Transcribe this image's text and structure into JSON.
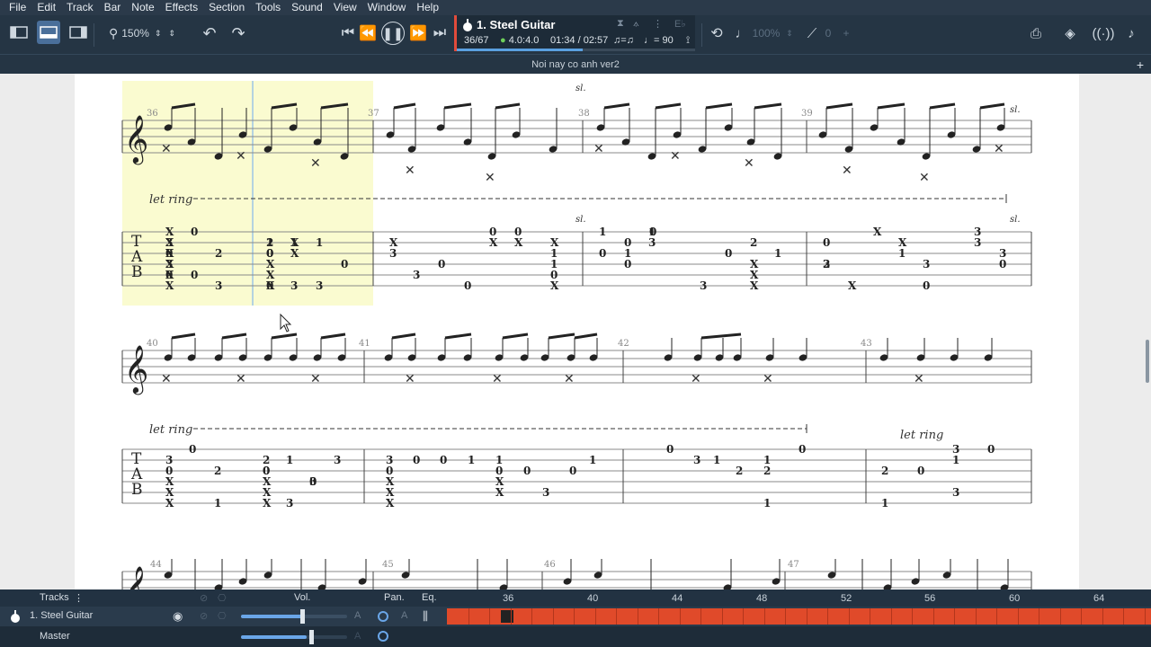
{
  "menu": [
    "File",
    "Edit",
    "Track",
    "Bar",
    "Note",
    "Effects",
    "Section",
    "Tools",
    "Sound",
    "View",
    "Window",
    "Help"
  ],
  "toolbar": {
    "zoom": "150%",
    "track_name": "1. Steel Guitar",
    "bar_position": "36/67",
    "time_signature": "4.0:4.0",
    "time": "01:34 / 02:57",
    "tempo": "= 90",
    "volume_pct": "100%",
    "capo": "0",
    "playback_progress": 0.53
  },
  "document": {
    "title": "Noi nay co anh ver2"
  },
  "score": {
    "bar_numbers": [
      "36",
      "37",
      "38",
      "39",
      "40",
      "41",
      "42",
      "43",
      "44",
      "45",
      "46",
      "47"
    ],
    "let_ring": "let ring",
    "slide": "sl.",
    "tab_letters": [
      "T",
      "A",
      "B"
    ],
    "system1_tab": [
      {
        "t": "0"
      },
      {
        "t": "3"
      },
      {
        "t": "0"
      },
      {
        "t": "X"
      },
      {
        "t": "X"
      },
      {
        "t": "X"
      },
      {
        "t": "2"
      },
      {
        "t": "1"
      },
      {
        "t": "3"
      },
      {
        "t": "2"
      },
      {
        "t": "0"
      },
      {
        "t": "X"
      },
      {
        "t": "X"
      },
      {
        "t": "X"
      },
      {
        "t": "1"
      },
      {
        "t": "3"
      },
      {
        "t": "0"
      },
      {
        "t": "X"
      },
      {
        "t": "3"
      },
      {
        "t": "3"
      },
      {
        "t": "0"
      },
      {
        "t": "0"
      },
      {
        "t": "0"
      },
      {
        "t": "0"
      },
      {
        "t": "X"
      },
      {
        "t": "X"
      },
      {
        "t": "1"
      },
      {
        "t": "1"
      },
      {
        "t": "0"
      },
      {
        "t": "X"
      },
      {
        "t": "X"
      },
      {
        "t": "1"
      },
      {
        "t": "0"
      },
      {
        "t": "3"
      },
      {
        "t": "1"
      },
      {
        "t": "0"
      },
      {
        "t": "1"
      },
      {
        "t": "0"
      },
      {
        "t": "0"
      },
      {
        "t": "3"
      },
      {
        "t": "0"
      },
      {
        "t": "X"
      },
      {
        "t": "X"
      },
      {
        "t": "X"
      },
      {
        "t": "2"
      },
      {
        "t": "1"
      },
      {
        "t": "3"
      },
      {
        "t": "2"
      },
      {
        "t": "0"
      },
      {
        "t": "X"
      },
      {
        "t": "X"
      },
      {
        "t": "X"
      },
      {
        "t": "1"
      },
      {
        "t": "3"
      },
      {
        "t": "0"
      },
      {
        "t": "3"
      },
      {
        "t": "3"
      },
      {
        "t": "3"
      },
      {
        "t": "0"
      },
      {
        "t": "0"
      },
      {
        "t": "X"
      },
      {
        "t": "X"
      },
      {
        "t": "X"
      },
      {
        "t": "3"
      },
      {
        "t": "0"
      },
      {
        "t": "3"
      },
      {
        "t": "X"
      },
      {
        "t": "X"
      },
      {
        "t": "0"
      },
      {
        "t": "1"
      },
      {
        "t": "0"
      }
    ],
    "system2_tab": [
      {
        "t": "0"
      },
      {
        "t": "3"
      },
      {
        "t": "0"
      },
      {
        "t": "X"
      },
      {
        "t": "X"
      },
      {
        "t": "X"
      },
      {
        "t": "2"
      },
      {
        "t": "1"
      },
      {
        "t": "3"
      },
      {
        "t": "2"
      },
      {
        "t": "0"
      },
      {
        "t": "X"
      },
      {
        "t": "X"
      },
      {
        "t": "X"
      },
      {
        "t": "1"
      },
      {
        "t": "3"
      },
      {
        "t": "0"
      },
      {
        "t": "3"
      },
      {
        "t": "0"
      },
      {
        "t": "3"
      },
      {
        "t": "0"
      },
      {
        "t": "X"
      },
      {
        "t": "X"
      },
      {
        "t": "X"
      },
      {
        "t": "0"
      },
      {
        "t": "0"
      },
      {
        "t": "1"
      },
      {
        "t": "1"
      },
      {
        "t": "0"
      },
      {
        "t": "X"
      },
      {
        "t": "X"
      },
      {
        "t": "3"
      },
      {
        "t": "0"
      },
      {
        "t": "0"
      },
      {
        "t": "1"
      },
      {
        "t": "0"
      },
      {
        "t": "3"
      },
      {
        "t": "1"
      },
      {
        "t": "2"
      },
      {
        "t": "1"
      },
      {
        "t": "2"
      },
      {
        "t": "1"
      },
      {
        "t": "0"
      },
      {
        "t": "2"
      },
      {
        "t": "1"
      },
      {
        "t": "0"
      },
      {
        "t": "3"
      },
      {
        "t": "1"
      },
      {
        "t": "3"
      },
      {
        "t": "0"
      }
    ]
  },
  "mixer": {
    "tracks_label": "Tracks",
    "vol_label": "Vol.",
    "pan_label": "Pan.",
    "eq_label": "Eq.",
    "track_row_name": "1. Steel Guitar",
    "master_label": "Master",
    "ruler": [
      "36",
      "40",
      "44",
      "48",
      "52",
      "56",
      "60",
      "64"
    ]
  },
  "colors": {
    "accent": "#e04a2a",
    "selection": "#fafbd0",
    "menubar": "#2b3a4a",
    "toolbar": "#253544"
  }
}
